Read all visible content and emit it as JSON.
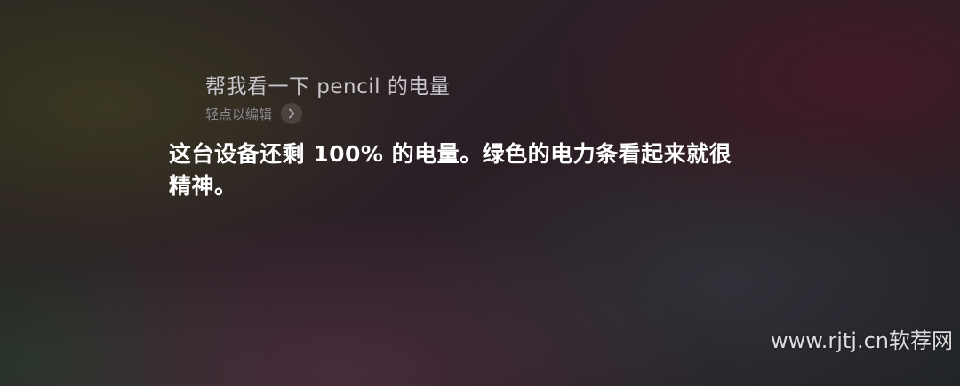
{
  "siri": {
    "query_text": "帮我看一下 pencil 的电量",
    "edit_hint": "轻点以编辑",
    "edit_icon": "chevron-right-icon",
    "response_line1": "这台设备还剩 100% 的电量。绿色的电力条看起来就很",
    "response_line2": "精神。"
  },
  "watermark": "www.rjtj.cn软荐网",
  "colors": {
    "query": "#c9c5cc",
    "hint": "#8c8890",
    "response": "#ffffff"
  }
}
